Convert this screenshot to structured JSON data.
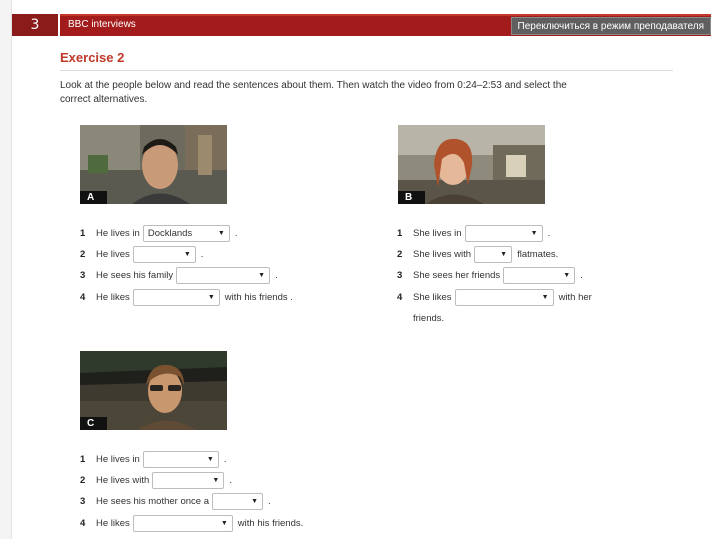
{
  "unit": {
    "number": "3"
  },
  "header": {
    "title": "BBC interviews",
    "teacher_mode": "Переключиться в режим преподавателя"
  },
  "exercise": {
    "title": "Exercise 2",
    "instructions": "Look at the people below and read the sentences about them. Then watch the video from 0:24–2:53 and select the correct alternatives."
  },
  "people": [
    {
      "label": "A",
      "questions": [
        {
          "num": "1",
          "before": "He lives in",
          "value": "Docklands",
          "after": "."
        },
        {
          "num": "2",
          "before": "He lives",
          "value": "",
          "after": "."
        },
        {
          "num": "3",
          "before": "He sees his family",
          "value": "",
          "after": "."
        },
        {
          "num": "4",
          "before": "He likes",
          "value": "",
          "after": "with his friends ."
        }
      ]
    },
    {
      "label": "B",
      "questions": [
        {
          "num": "1",
          "before": "She lives in",
          "value": "",
          "after": "."
        },
        {
          "num": "2",
          "before": "She lives with",
          "value": "",
          "after": "flatmates."
        },
        {
          "num": "3",
          "before": "She sees her friends",
          "value": "",
          "after": "."
        },
        {
          "num": "4",
          "before": "She likes",
          "value": "",
          "after": "with her",
          "cont": "friends."
        }
      ]
    },
    {
      "label": "C",
      "questions": [
        {
          "num": "1",
          "before": "He lives in",
          "value": "",
          "after": "."
        },
        {
          "num": "2",
          "before": "He lives with",
          "value": "",
          "after": "."
        },
        {
          "num": "3",
          "before": "He sees his mother once a",
          "value": "",
          "after": "."
        },
        {
          "num": "4",
          "before": "He likes",
          "value": "",
          "after": "with his friends."
        }
      ]
    }
  ]
}
